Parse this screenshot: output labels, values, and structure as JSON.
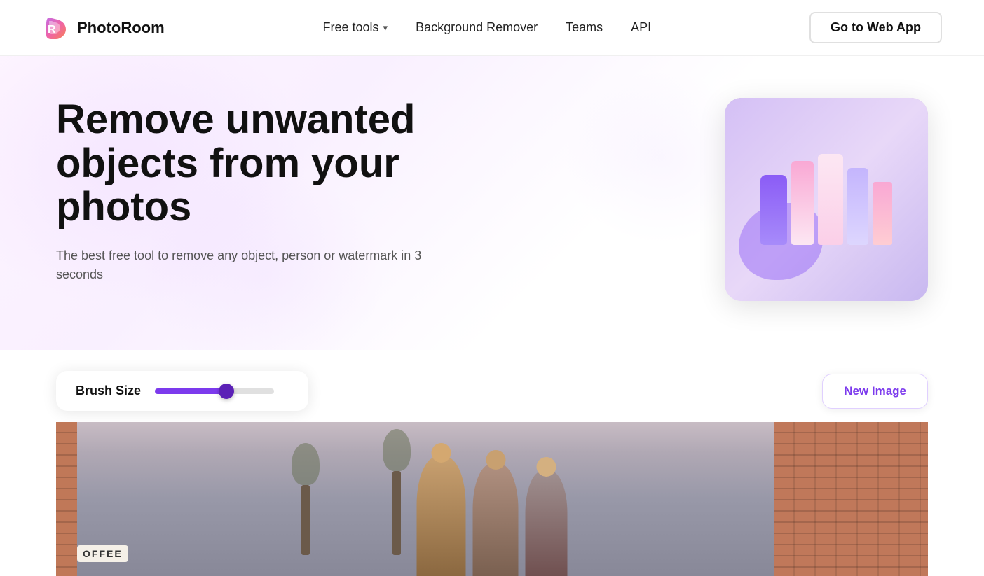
{
  "brand": {
    "name": "PhotoRoom",
    "logo_alt": "PhotoRoom logo"
  },
  "nav": {
    "free_tools_label": "Free tools",
    "background_remover_label": "Background Remover",
    "teams_label": "Teams",
    "api_label": "API",
    "go_to_web_app_label": "Go to Web App"
  },
  "hero": {
    "title": "Remove unwanted objects from your photos",
    "subtitle": "The best free tool to remove any object, person or watermark in 3 seconds"
  },
  "tool": {
    "brush_size_label": "Brush Size",
    "new_image_label": "New Image"
  }
}
